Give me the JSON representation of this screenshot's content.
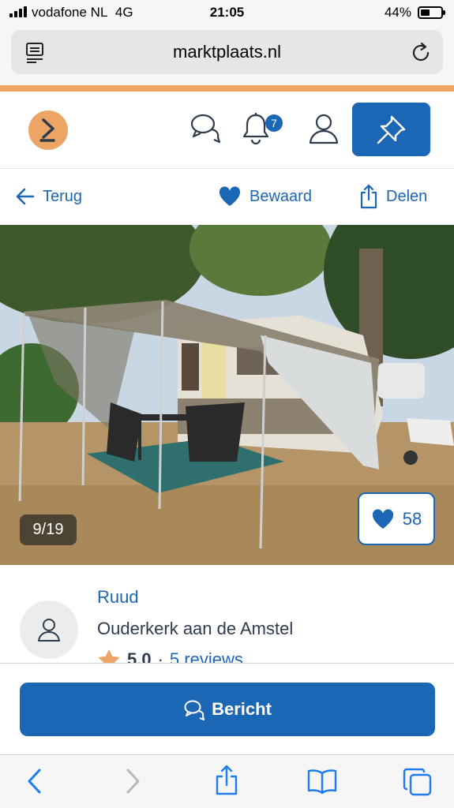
{
  "status_bar": {
    "carrier": "vodafone NL",
    "network": "4G",
    "time": "21:05",
    "battery": "44%",
    "battery_level": 0.44
  },
  "browser": {
    "url": "marktplaats.nl"
  },
  "header": {
    "notification_count": "7"
  },
  "actions": {
    "back": "Terug",
    "saved": "Bewaard",
    "share": "Delen"
  },
  "photo": {
    "counter": "9/19",
    "favorites": "58"
  },
  "seller": {
    "name": "Ruud",
    "location": "Ouderkerk aan de Amstel",
    "score": "5.0",
    "separator": "·",
    "reviews": "5 reviews"
  },
  "message_button": {
    "label": "Bericht"
  },
  "colors": {
    "brand_blue": "#1c66b6",
    "brand_orange": "#eda565"
  },
  "icons": [
    "reader-icon",
    "reload-icon",
    "logo-icon",
    "chat-icon",
    "bell-icon",
    "user-icon",
    "pin-icon",
    "arrow-left-icon",
    "heart-icon",
    "share-icon",
    "avatar-icon",
    "star-icon",
    "message-icon",
    "chevron-left-icon",
    "chevron-right-icon",
    "share-sheet-icon",
    "book-icon",
    "tabs-icon"
  ]
}
